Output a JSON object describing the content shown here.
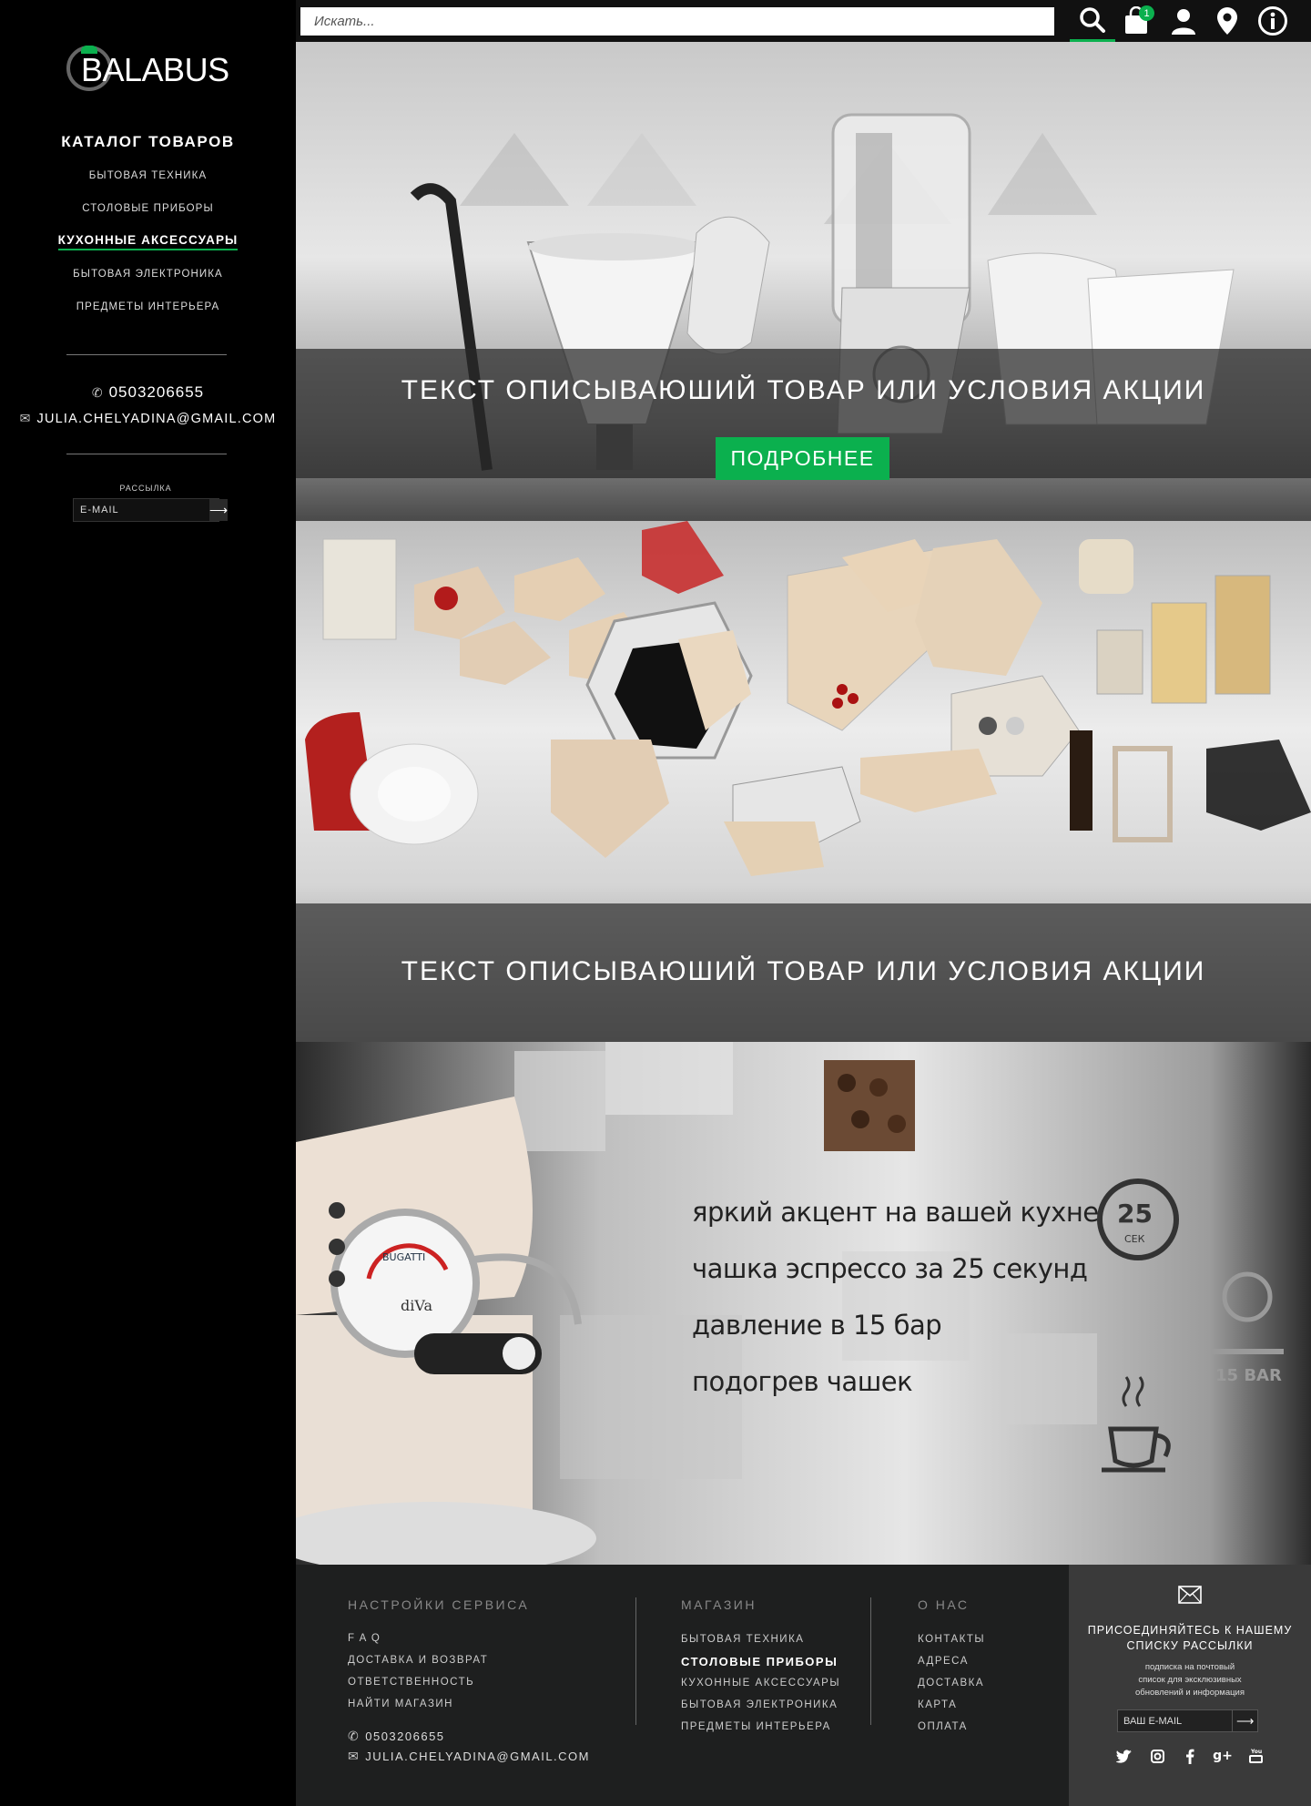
{
  "brand": {
    "logo_text": "BALABUS"
  },
  "search": {
    "placeholder": "Искать..."
  },
  "header": {
    "cart_count": "1"
  },
  "sidebar": {
    "catalog_title": "КАТАЛОГ ТОВАРОВ",
    "items": [
      {
        "label": "БЫТОВАЯ ТЕХНИКА"
      },
      {
        "label": "СТОЛОВЫЕ ПРИБОРЫ"
      },
      {
        "label": "КУХОННЫЕ АКСЕССУАРЫ"
      },
      {
        "label": "БЫТОВАЯ ЭЛЕКТРОНИКА"
      },
      {
        "label": "ПРЕДМЕТЫ ИНТЕРЬЕРА"
      }
    ],
    "phone": "0503206655",
    "email": "JULIA.CHELYADINA@GMAIL.COM",
    "newsletter_label": "РАССЫЛКА",
    "newsletter_placeholder": "E-MAIL"
  },
  "banners": [
    {
      "text": "ТЕКСТ ОПИСЫВАЮШИЙ ТОВАР ИЛИ УСЛОВИЯ АКЦИИ",
      "button": "ПОДРОБНЕЕ"
    },
    {
      "text": "ТЕКСТ ОПИСЫВАЮШИЙ ТОВАР ИЛИ УСЛОВИЯ АКЦИИ"
    },
    {
      "features": [
        "яркий акцент на вашей кухне",
        "чашка эспрессо за 25 секунд",
        "давление в 15 бар",
        "подогрев чашек"
      ],
      "timer_value": "25",
      "timer_unit": "СЕК",
      "pressure_label": "15 BAR",
      "machine_brand": "BUGATTI",
      "machine_model": "diVa"
    }
  ],
  "footer": {
    "service": {
      "heading": "НАСТРОЙКИ СЕРВИСА",
      "links": [
        "F A Q",
        "ДОСТАВКА И ВОЗВРАТ",
        "ОТВЕТСТВЕННОСТЬ",
        "НАЙТИ МАГАЗИН"
      ],
      "phone": "0503206655",
      "email": "JULIA.CHELYADINA@GMAIL.COM"
    },
    "shop": {
      "heading": "МАГАЗИН",
      "links": [
        "БЫТОВАЯ ТЕХНИКА",
        "СТОЛОВЫЕ ПРИБОРЫ",
        "КУХОННЫЕ АКСЕССУАРЫ",
        "БЫТОВАЯ ЭЛЕКТРОНИКА",
        "ПРЕДМЕТЫ ИНТЕРЬЕРА"
      ]
    },
    "about": {
      "heading": "О НАС",
      "links": [
        "КОНТАКТЫ",
        "АДРЕСА",
        "ДОСТАВКА",
        "КАРТА",
        "ОПЛАТА"
      ]
    },
    "subscribe": {
      "title_line1": "ПРИСОЕДИНЯЙТЕСЬ К НАШЕМУ",
      "title_line2": "СПИСКУ РАССЫЛКИ",
      "desc_line1": "подписка на почтовый",
      "desc_line2": "список для эксклюзивных",
      "desc_line3": "обновлений и информация",
      "placeholder": "ВАШ E-MAIL"
    },
    "socials": [
      "twitter-icon",
      "instagram-icon",
      "facebook-icon",
      "google-plus-icon",
      "youtube-icon"
    ]
  },
  "colors": {
    "accent": "#0bb04e",
    "background": "#000000",
    "footer": "#1e1f1f",
    "subscribe_box": "#3a3a3a"
  }
}
